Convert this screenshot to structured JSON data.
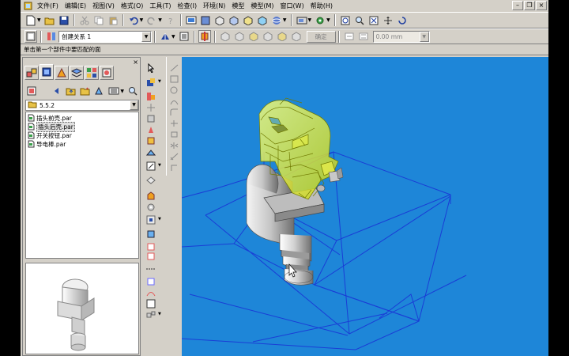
{
  "menu": [
    "文件(F)",
    "编辑(E)",
    "视图(V)",
    "格式(O)",
    "工具(T)",
    "检查(I)",
    "环境(N)",
    "模型",
    "模型(M)",
    "窗口(W)",
    "帮助(H)"
  ],
  "toolbar2": {
    "relation_combo": "创建关系 1",
    "confirm_button": "确定",
    "offset_value": "0.00 mm"
  },
  "status_prompt": "单击第一个部件中要匹配的面",
  "folder": "5.5.2",
  "files": [
    {
      "name": "插头前壳.par",
      "selected": false
    },
    {
      "name": "插头后壳.par",
      "selected": true
    },
    {
      "name": "开关按钮.par",
      "selected": false
    },
    {
      "name": "导电棒.par",
      "selected": false
    }
  ],
  "colors": {
    "viewport_bg": "#1e86d8",
    "selected_part": "#e6f01e",
    "reference_plane": "#1a3dd6",
    "panel_bg": "#d4d0c8"
  },
  "icons": {
    "file_icon": "part-file-icon",
    "folder_icon": "folder-icon"
  }
}
